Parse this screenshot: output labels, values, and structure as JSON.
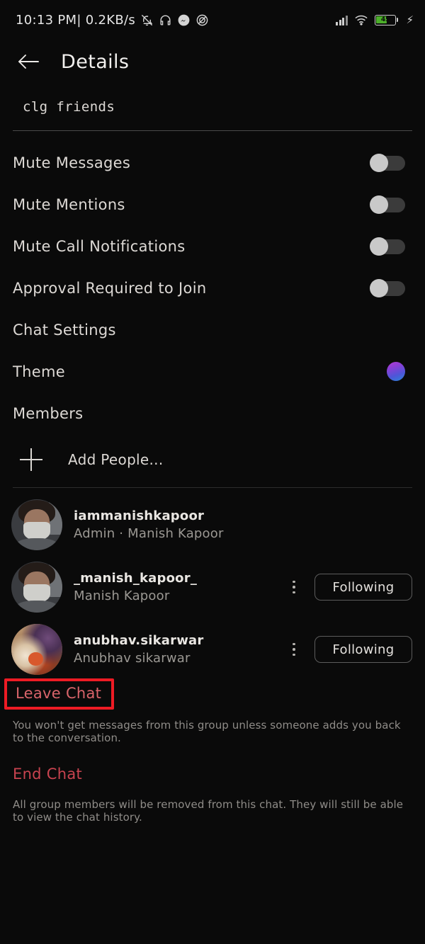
{
  "status_bar": {
    "clock": "10:13 PM| 0.2KB/s",
    "icons": [
      "bell-muted-icon",
      "headphone-icon",
      "messenger-icon",
      "dnd-icon"
    ],
    "signal_icon": "signal-bars-icon",
    "wifi_icon": "wifi-icon",
    "battery_level": "45",
    "charging_icon": "charging-bolt-icon"
  },
  "header": {
    "back_icon": "back-arrow-icon",
    "title": "Details"
  },
  "group_name": {
    "value": "clg friends"
  },
  "settings": {
    "rows": [
      {
        "label": "Mute Messages",
        "control": "toggle",
        "state": "off"
      },
      {
        "label": "Mute Mentions",
        "control": "toggle",
        "state": "off"
      },
      {
        "label": "Mute Call Notifications",
        "control": "toggle",
        "state": "off"
      },
      {
        "label": "Approval Required to Join",
        "control": "toggle",
        "state": "off"
      },
      {
        "label": "Chat Settings",
        "control": "none"
      },
      {
        "label": "Theme",
        "control": "color-swatch",
        "swatch_from": "#b33bd4",
        "swatch_to": "#2b86d9"
      },
      {
        "label": "Members",
        "control": "none"
      }
    ]
  },
  "add_people": {
    "icon": "plus-icon",
    "label": "Add People..."
  },
  "members": [
    {
      "username": "iammanishkapoor",
      "subtitle": "Admin · Manish Kapoor",
      "avatar": "avatar-masked-person",
      "has_menu": false,
      "action_label": ""
    },
    {
      "username": "_manish_kapoor_",
      "subtitle": "Manish Kapoor",
      "avatar": "avatar-masked-person",
      "has_menu": true,
      "action_label": "Following"
    },
    {
      "username": "anubhav.sikarwar",
      "subtitle": "Anubhav sikarwar",
      "avatar": "avatar-ceremony-photo",
      "has_menu": true,
      "action_label": "Following"
    }
  ],
  "danger": {
    "leave_label": "Leave Chat",
    "leave_desc": "You won't get messages from this group unless someone adds you back to the conversation.",
    "end_label": "End Chat",
    "end_desc": "All group members will be removed from this chat. They will still be able to view the chat history.",
    "highlight_color": "#ee1b24",
    "leave_text_color": "#d9646a",
    "end_text_color": "#c8434f"
  }
}
